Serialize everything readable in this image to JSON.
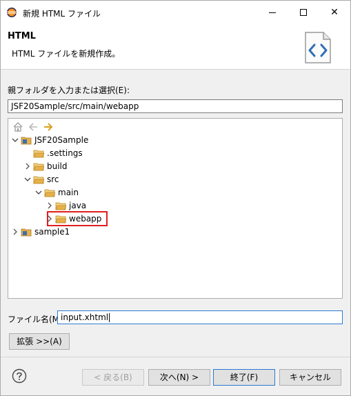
{
  "window": {
    "title": "新規 HTML ファイル",
    "app_icon": "eclipse-icon",
    "controls": [
      "minimize-icon",
      "maximize-icon",
      "close-icon"
    ]
  },
  "header": {
    "title": "HTML",
    "description": "HTML ファイルを新規作成。",
    "icon": "html-file-icon"
  },
  "parent_folder": {
    "label": "親フォルダを入力または選択(E):",
    "value": "JSF20Sample/src/main/webapp"
  },
  "tree": {
    "toolbar": [
      "home-icon",
      "back-icon",
      "forward-icon"
    ],
    "nodes": [
      {
        "label": "JSF20Sample",
        "type": "project",
        "expanded": true
      },
      {
        "label": ".settings",
        "type": "folder"
      },
      {
        "label": "build",
        "type": "folder",
        "expanded": false
      },
      {
        "label": "src",
        "type": "folder",
        "expanded": true
      },
      {
        "label": "main",
        "type": "folder",
        "expanded": true
      },
      {
        "label": "java",
        "type": "folder",
        "expanded": false
      },
      {
        "label": "webapp",
        "type": "folder",
        "expanded": false,
        "selected": true
      },
      {
        "label": "sample1",
        "type": "project",
        "expanded": false
      }
    ]
  },
  "file_name": {
    "label": "ファイル名(M):",
    "value": "input.xhtml"
  },
  "buttons": {
    "advanced": "拡張 >>(A)",
    "back": "< 戻る(B)",
    "next": "次へ(N) >",
    "finish": "終了(F)",
    "cancel": "キャンセル"
  },
  "colors": {
    "highlight_border": "#e01e1e",
    "focus_border": "#2b79d4",
    "folder": "#e8b04a"
  }
}
